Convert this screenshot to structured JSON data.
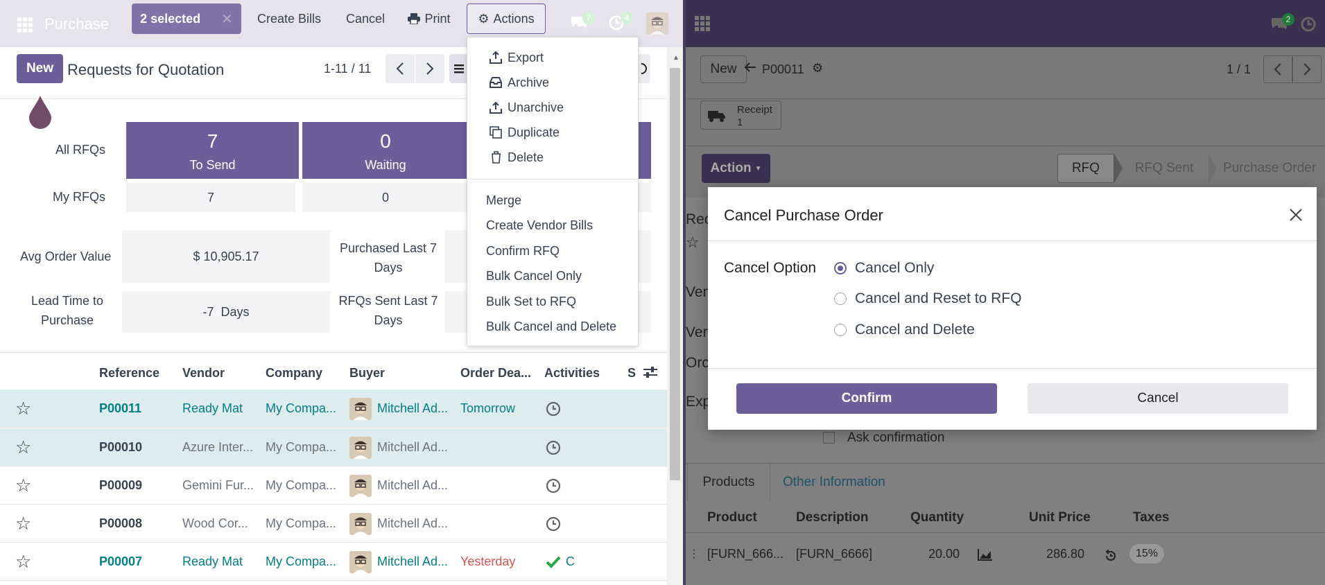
{
  "left": {
    "app_name": "Purchase",
    "selection": {
      "count_label": "2 selected",
      "create_bills": "Create Bills",
      "cancel": "Cancel",
      "print": "Print",
      "actions": "Actions"
    },
    "badges": {
      "messages": "7",
      "activities": "4"
    },
    "control": {
      "new": "New",
      "title": "Requests for Quotation",
      "pager": "1-11 / 11"
    },
    "dashboard": {
      "all_rfqs": "All RFQs",
      "my_rfqs": "My RFQs",
      "tiles": [
        {
          "value": "7",
          "label": "To Send",
          "mine": "7"
        },
        {
          "value": "0",
          "label": "Waiting",
          "mine": "0"
        }
      ],
      "avg_order_value_label": "Avg Order Value",
      "avg_order_value": "$ 10,905.17",
      "purchased_last_7_label": "Purchased Last 7 Days",
      "lead_time_label": "Lead Time to Purchase",
      "lead_time": "-7  Days",
      "rfqs_sent_last_7_label": "RFQs Sent Last 7 Days"
    },
    "table": {
      "headers": [
        "Reference",
        "Vendor",
        "Company",
        "Buyer",
        "Order Dea...",
        "Activities",
        "S"
      ],
      "rows": [
        {
          "ref": "P00011",
          "vendor": "Ready Mat",
          "company": "My Compa...",
          "buyer": "Mitchell Ad...",
          "deadline": "Tomorrow",
          "activity": "",
          "selected": true,
          "style": "link",
          "deadline_color": "#017e84"
        },
        {
          "ref": "P00010",
          "vendor": "Azure Inter...",
          "company": "My Compa...",
          "buyer": "Mitchell Ad...",
          "deadline": "",
          "activity": "",
          "selected": true,
          "style": "grey",
          "deadline_color": ""
        },
        {
          "ref": "P00009",
          "vendor": "Gemini Fur...",
          "company": "My Compa...",
          "buyer": "Mitchell Ad...",
          "deadline": "",
          "activity": "",
          "selected": false,
          "style": "grey",
          "deadline_color": ""
        },
        {
          "ref": "P00008",
          "vendor": "Wood Cor...",
          "company": "My Compa...",
          "buyer": "Mitchell Ad...",
          "deadline": "",
          "activity": "",
          "selected": false,
          "style": "grey",
          "deadline_color": ""
        },
        {
          "ref": "P00007",
          "vendor": "Ready Mat",
          "company": "My Compa...",
          "buyer": "Mitchell Ad...",
          "deadline": "Yesterday",
          "activity": "C",
          "selected": false,
          "style": "link",
          "deadline_color": "#d9534f"
        }
      ]
    }
  },
  "actions_menu": {
    "items": [
      "Export",
      "Archive",
      "Unarchive",
      "Duplicate",
      "Delete"
    ],
    "server_actions": [
      "Merge",
      "Create Vendor Bills",
      "Confirm RFQ",
      "Bulk Cancel Only",
      "Bulk Set to RFQ",
      "Bulk Cancel and Delete"
    ]
  },
  "right": {
    "badge_messages": "2",
    "new": "New",
    "breadcrumb_ref": "P00011",
    "pager": "1 / 1",
    "receipt_label": "Receipt",
    "receipt_count": "1",
    "action_btn": "Action",
    "statusbar": [
      "RFQ",
      "RFQ Sent",
      "Purchase Order"
    ],
    "partial_labels": [
      "Rec",
      "Ven",
      "Ven",
      "Orc",
      "Exp"
    ],
    "ask_confirmation": "Ask confirmation",
    "tabs": [
      "Products",
      "Other Information"
    ],
    "line_headers": [
      "Product",
      "Description",
      "Quantity",
      "Unit Price",
      "Taxes"
    ],
    "line": {
      "product": "[FURN_666...",
      "description": "[FURN_6666]",
      "quantity": "20.00",
      "unit_price": "286.80",
      "tax": "15%"
    }
  },
  "dialog": {
    "title": "Cancel Purchase Order",
    "field_label": "Cancel Option",
    "options": [
      "Cancel Only",
      "Cancel and Reset to RFQ",
      "Cancel and Delete"
    ],
    "selected_option": "Cancel Only",
    "confirm": "Confirm",
    "cancel": "Cancel"
  },
  "colors": {
    "brand": "#6c5f99",
    "link": "#017e84",
    "danger": "#d9534f",
    "selected_row": "#dcecef"
  }
}
